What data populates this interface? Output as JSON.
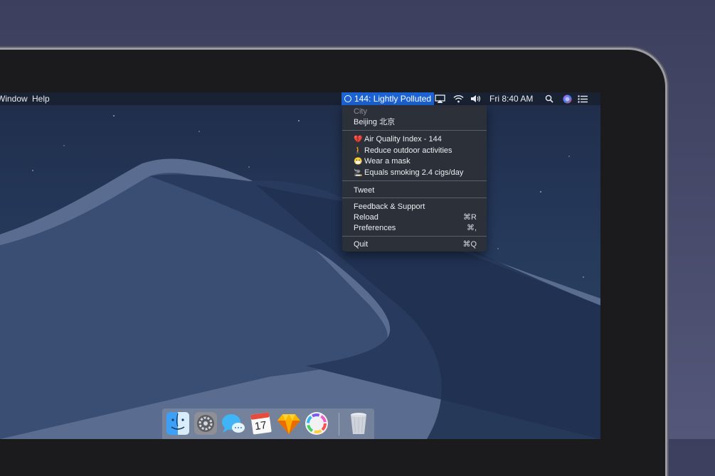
{
  "menubar": {
    "left_items": [
      "Window",
      "Help"
    ],
    "status_item": "144: Lightly Polluted",
    "clock": "Fri 8:40 AM"
  },
  "menu": {
    "city_header": "City",
    "city": "Beijing 北京",
    "info_items": [
      {
        "icon": "broken-heart-icon",
        "label": "Air Quality Index - 144"
      },
      {
        "icon": "walking-person-icon",
        "label": "Reduce outdoor activities"
      },
      {
        "icon": "mask-face-icon",
        "label": "Wear a mask"
      },
      {
        "icon": "smoking-icon",
        "label": "Equals smoking 2.4 cigs/day"
      }
    ],
    "tweet": "Tweet",
    "feedback": "Feedback & Support",
    "reload": {
      "label": "Reload",
      "shortcut": "⌘R"
    },
    "preferences": {
      "label": "Preferences",
      "shortcut": "⌘,"
    },
    "quit": {
      "label": "Quit",
      "shortcut": "⌘Q"
    }
  },
  "dock": {
    "calendar_day": "17",
    "apps": [
      "finder-icon",
      "system-preferences-icon",
      "messages-icon",
      "calendar-icon",
      "sketch-icon",
      "color-ring-app-icon",
      "trash-icon"
    ]
  },
  "colors": {
    "menubar_highlight": "#1b63d3",
    "menu_bg": "#2d3038"
  }
}
